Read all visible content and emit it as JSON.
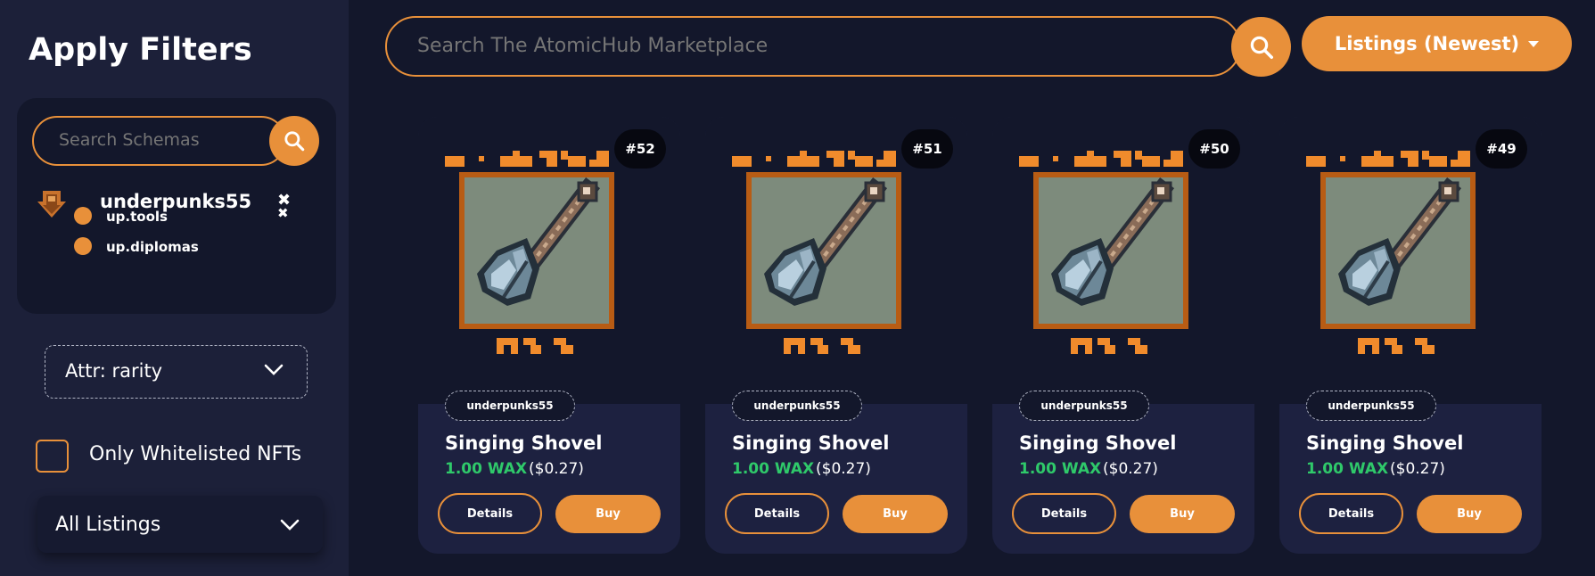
{
  "sidebar": {
    "title": "Apply Filters",
    "schema_search_placeholder": "Search Schemas",
    "collection": "underpunks55",
    "schemas": [
      "up.tools",
      "up.diplomas"
    ],
    "attribute_select": "Attr: rarity",
    "whitelist_label": "Only Whitelisted NFTs",
    "listings_select": "All Listings"
  },
  "header": {
    "search_placeholder": "Search The AtomicHub Marketplace",
    "sort_label": "Listings (Newest)"
  },
  "colors": {
    "accent": "#e8903a",
    "price_green": "#2fc96a",
    "background": "#13172b",
    "sidebar": "#1c2039"
  },
  "cards": [
    {
      "number": "#52",
      "collection": "underpunks55",
      "name": "Singing Shovel",
      "price_wax": "1.00 WAX",
      "price_usd": "($0.27)",
      "details_label": "Details",
      "buy_label": "Buy"
    },
    {
      "number": "#51",
      "collection": "underpunks55",
      "name": "Singing Shovel",
      "price_wax": "1.00 WAX",
      "price_usd": "($0.27)",
      "details_label": "Details",
      "buy_label": "Buy"
    },
    {
      "number": "#50",
      "collection": "underpunks55",
      "name": "Singing Shovel",
      "price_wax": "1.00 WAX",
      "price_usd": "($0.27)",
      "details_label": "Details",
      "buy_label": "Buy"
    },
    {
      "number": "#49",
      "collection": "underpunks55",
      "name": "Singing Shovel",
      "price_wax": "1.00 WAX",
      "price_usd": "($0.27)",
      "details_label": "Details",
      "buy_label": "Buy"
    }
  ]
}
